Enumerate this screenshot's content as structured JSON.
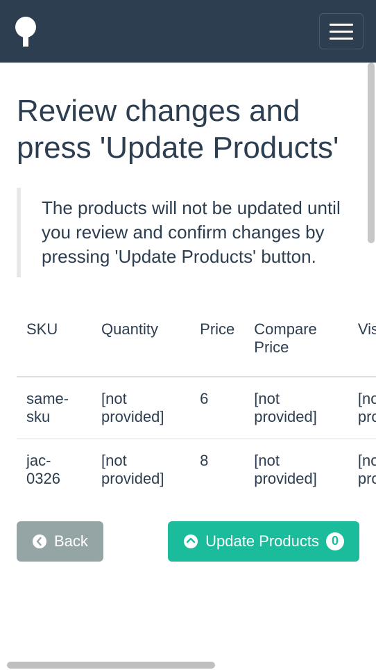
{
  "header": {
    "logo_name": "tree-logo"
  },
  "page": {
    "title": "Review changes and press 'Update Products'",
    "notice": "The products will not be updated until you review and confirm changes by pressing 'Update Products' button."
  },
  "table": {
    "headers": [
      "SKU",
      "Quantity",
      "Price",
      "Compare Price",
      "Visible"
    ],
    "rows": [
      {
        "sku": "same-sku",
        "quantity": "[not provided]",
        "price": "6",
        "compare_price": "[not provided]",
        "visible": "[not provided]"
      },
      {
        "sku": "jac-0326",
        "quantity": "[not provided]",
        "price": "8",
        "compare_price": "[not provided]",
        "visible": "[not provided]"
      }
    ]
  },
  "buttons": {
    "back_label": "Back",
    "update_label": "Update Products",
    "update_count": "0"
  },
  "colors": {
    "navbar": "#2c3e50",
    "primary": "#1abc9c",
    "secondary": "#95a5a6"
  }
}
